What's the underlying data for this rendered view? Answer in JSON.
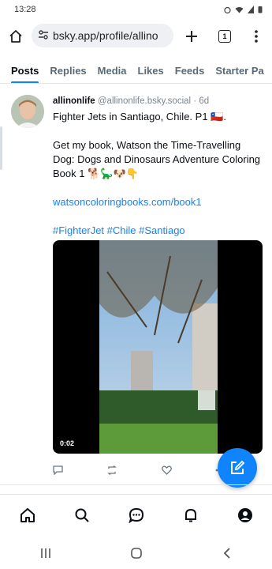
{
  "status_bar": {
    "time": "13:28"
  },
  "browser": {
    "url": "bsky.app/profile/allino",
    "tab_count": "1",
    "icons": [
      "home-icon",
      "site-settings-icon",
      "add-tab-icon",
      "tabs-icon",
      "more-icon"
    ]
  },
  "profile_tabs": [
    "Posts",
    "Replies",
    "Media",
    "Likes",
    "Feeds",
    "Starter Pa"
  ],
  "post": {
    "display_name": "allinonlife",
    "handle": "@allinonlife.bsky.social",
    "age": "· 6d",
    "line1": "Fighter Jets in Santiago, Chile. P1 🇨🇱.",
    "line2": "Get my book, Watson the Time-Travelling Dog: Dogs and Dinosaurs Adventure Coloring Book 1 🐕🦕🐶👇",
    "link": "watsoncoloringbooks.com/book1",
    "hashtags": "#FighterJet #Chile #Santiago",
    "video_time": "0:02"
  },
  "colors": {
    "accent": "#1083fe",
    "text": "#0b0f14",
    "muted": "#5b6875"
  },
  "bottom_nav": [
    "home-icon",
    "search-icon",
    "chat-icon",
    "bell-icon",
    "profile-icon"
  ],
  "android_nav": [
    "recents-icon",
    "home-button-icon",
    "back-icon"
  ]
}
